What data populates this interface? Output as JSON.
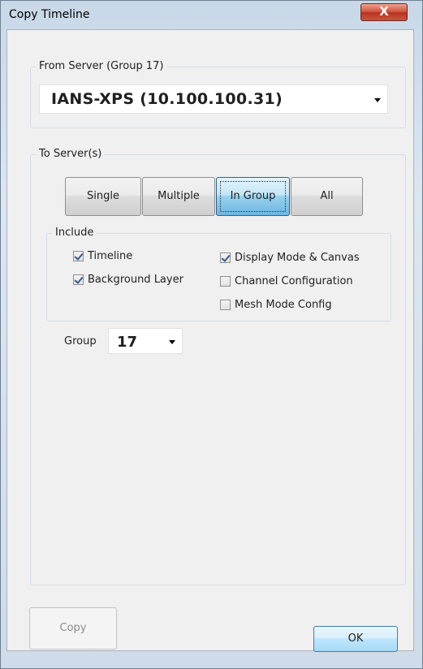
{
  "window": {
    "title": "Copy Timeline",
    "close_glyph": "X"
  },
  "from_server": {
    "caption": "From Server  (Group 17)",
    "selected": "IANS-XPS  (10.100.100.31)"
  },
  "to_servers": {
    "caption": "To Server(s)",
    "modes": [
      {
        "label": "Single",
        "active": false
      },
      {
        "label": "Multiple",
        "active": false
      },
      {
        "label": "In Group",
        "active": true
      },
      {
        "label": "All",
        "active": false
      }
    ]
  },
  "include": {
    "caption": "Include",
    "options": [
      {
        "label": "Timeline",
        "checked": true
      },
      {
        "label": "Background Layer",
        "checked": true
      },
      {
        "label": "Display Mode & Canvas",
        "checked": true
      },
      {
        "label": "Channel Configuration",
        "checked": false
      },
      {
        "label": "Mesh Mode Config",
        "checked": false
      }
    ]
  },
  "group": {
    "label": "Group",
    "selected": "17"
  },
  "buttons": {
    "copy_label": "Copy",
    "ok_label": "OK"
  },
  "colors": {
    "active_button": "#98d1ef",
    "close_button": "#c8563f",
    "disabled_text": "#8b8b8b"
  },
  "icons": {
    "close": "close-icon",
    "dropdown": "chevron-down-icon",
    "checkbox": "checkbox-icon"
  }
}
